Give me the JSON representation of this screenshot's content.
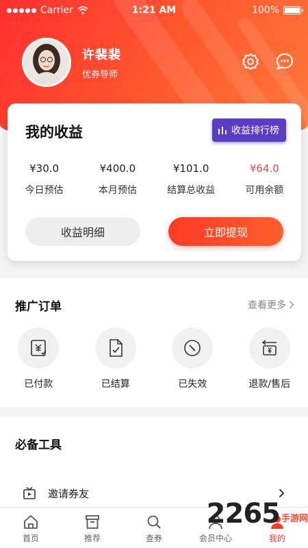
{
  "status_bar": {
    "carrier": "Carrier",
    "time": "1:21 AM",
    "battery": "100%"
  },
  "profile": {
    "name": "许裴裴",
    "role": "优券导师"
  },
  "earnings": {
    "title": "我的收益",
    "rank_button": "收益排行榜",
    "stats": [
      {
        "value": "¥30.0",
        "label": "今日预估"
      },
      {
        "value": "¥400.0",
        "label": "本月预估"
      },
      {
        "value": "¥101.0",
        "label": "结算总收益"
      },
      {
        "value": "¥64.0",
        "label": "可用余额"
      }
    ],
    "detail_button": "收益明细",
    "withdraw_button": "立即提现"
  },
  "orders": {
    "title": "推广订单",
    "see_more": "查看更多",
    "items": [
      {
        "label": "已付款",
        "icon": "paid-icon"
      },
      {
        "label": "已结算",
        "icon": "settled-icon"
      },
      {
        "label": "已失效",
        "icon": "expired-icon"
      },
      {
        "label": "退款/售后",
        "icon": "refund-icon"
      }
    ]
  },
  "tools": {
    "title": "必备工具",
    "items": [
      {
        "label": "邀请券友",
        "icon": "invite-icon"
      }
    ]
  },
  "tabbar": {
    "items": [
      {
        "label": "首页",
        "icon": "home-icon"
      },
      {
        "label": "推荐",
        "icon": "recommend-icon"
      },
      {
        "label": "查券",
        "icon": "search-icon"
      },
      {
        "label": "会员中心",
        "icon": "member-icon"
      },
      {
        "label": "我的",
        "icon": "profile-icon"
      }
    ]
  },
  "watermark": {
    "brand_number": "2265",
    "brand_site": "手游网"
  },
  "colors": {
    "accent": "#ff3b26",
    "rank_purple": "#5b3cc4",
    "balance_red": "#e8484a"
  }
}
